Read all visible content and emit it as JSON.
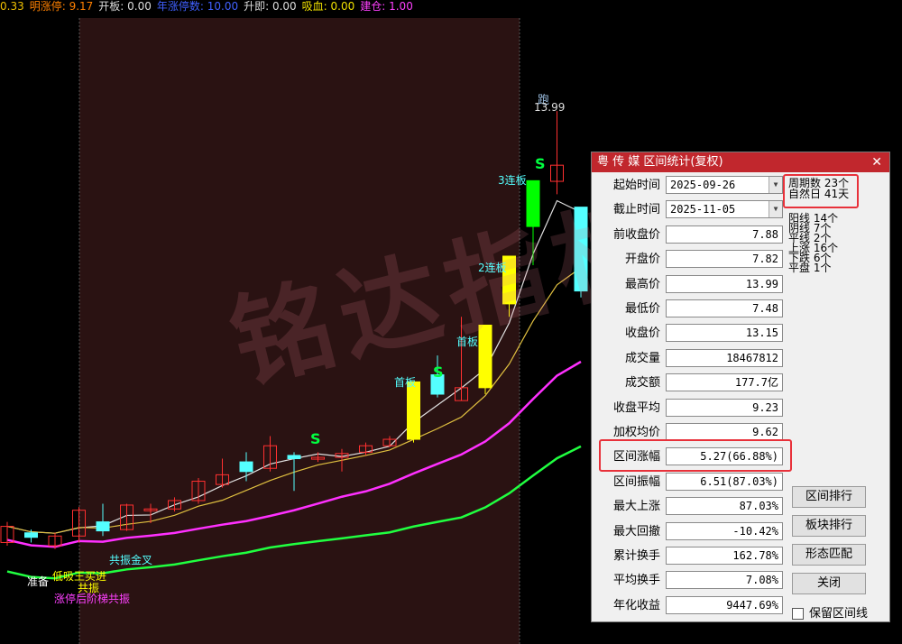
{
  "topbar": [
    {
      "text": "0.33",
      "color": "#f0c000"
    },
    {
      "text": "明涨停: 9.17",
      "color": "#ff8000"
    },
    {
      "text": "开板: 0.00",
      "color": "#dddddd"
    },
    {
      "text": "年涨停数: 10.00",
      "color": "#4060ff"
    },
    {
      "text": "升即: 0.00",
      "color": "#dddddd"
    },
    {
      "text": "吸血: 0.00",
      "color": "#f0e000"
    },
    {
      "text": "建仓: 1.00",
      "color": "#ff40ff"
    }
  ],
  "watermark": "铭达指标",
  "chart_labels": {
    "peak_run": "跑",
    "peak_value": "13.99",
    "limit3": "3连板",
    "limit2": "2连板",
    "first_board_a": "首板",
    "first_board_b": "首板",
    "s1": "S",
    "s2": "S",
    "s3": "S",
    "gold_cross": "共振金叉",
    "prepare": "准备",
    "text_a": "低吸王买进",
    "text_b": "共振",
    "text_c": "涨停后阶梯共振"
  },
  "dialog": {
    "title": "粤 传 媒 区间统计(复权)",
    "close": "✕",
    "rows": [
      {
        "label": "起始时间",
        "value": "2025-09-26",
        "type": "date"
      },
      {
        "label": "截止时间",
        "value": "2025-11-05",
        "type": "date"
      },
      {
        "label": "前收盘价",
        "value": "7.88"
      },
      {
        "label": "开盘价",
        "value": "7.82"
      },
      {
        "label": "最高价",
        "value": "13.99"
      },
      {
        "label": "最低价",
        "value": "7.48"
      },
      {
        "label": "收盘价",
        "value": "13.15"
      },
      {
        "label": "成交量",
        "value": "18467812"
      },
      {
        "label": "成交额",
        "value": "177.7亿"
      },
      {
        "label": "收盘平均",
        "value": "9.23"
      },
      {
        "label": "加权均价",
        "value": "9.62"
      },
      {
        "label": "区间涨幅",
        "value": "5.27(66.88%)"
      },
      {
        "label": "区间振幅",
        "value": "6.51(87.03%)"
      },
      {
        "label": "最大上涨",
        "value": "87.03%"
      },
      {
        "label": "最大回撤",
        "value": "-10.42%"
      },
      {
        "label": "累计换手",
        "value": "162.78%"
      },
      {
        "label": "平均换手",
        "value": "7.08%"
      },
      {
        "label": "年化收益",
        "value": "9447.69%"
      }
    ],
    "period": [
      "周期数  23个",
      "自然日  41天"
    ],
    "counts": [
      "阳线 14个",
      "阴线  7个",
      "平线  2个",
      "上涨 16个",
      "下跌  6个",
      "平盘  1个"
    ],
    "buttons": [
      "区间排行",
      "板块排行",
      "形态匹配",
      "关闭"
    ],
    "checkbox_label": "保留区间线"
  },
  "chart_data": {
    "type": "candlestick",
    "colors": {
      "up": "#ff3030",
      "down": "#54ffff",
      "limit_up": "#ffff00",
      "limit_up_3": "#00ff00"
    },
    "candles": [
      {
        "o": 7.3,
        "c": 7.55,
        "h": 7.62,
        "l": 7.25
      },
      {
        "o": 7.45,
        "c": 7.38,
        "h": 7.5,
        "l": 7.3
      },
      {
        "o": 7.25,
        "c": 7.4,
        "h": 7.45,
        "l": 7.2
      },
      {
        "o": 7.4,
        "c": 7.8,
        "h": 7.85,
        "l": 7.3
      },
      {
        "o": 7.62,
        "c": 7.48,
        "h": 7.9,
        "l": 7.4
      },
      {
        "o": 7.5,
        "c": 7.88,
        "h": 7.9,
        "l": 7.48
      },
      {
        "o": 7.82,
        "c": 7.82,
        "h": 7.9,
        "l": 7.6
      },
      {
        "o": 7.82,
        "c": 7.95,
        "h": 8.0,
        "l": 7.78
      },
      {
        "o": 7.95,
        "c": 8.25,
        "h": 8.3,
        "l": 7.9
      },
      {
        "o": 8.2,
        "c": 8.35,
        "h": 8.6,
        "l": 8.15
      },
      {
        "o": 8.55,
        "c": 8.4,
        "h": 8.7,
        "l": 8.25
      },
      {
        "o": 8.45,
        "c": 8.8,
        "h": 8.95,
        "l": 8.4
      },
      {
        "o": 8.65,
        "c": 8.6,
        "h": 8.7,
        "l": 8.1
      },
      {
        "o": 8.62,
        "c": 8.62,
        "h": 8.7,
        "l": 8.55
      },
      {
        "o": 8.62,
        "c": 8.68,
        "h": 8.75,
        "l": 8.4
      },
      {
        "o": 8.7,
        "c": 8.8,
        "h": 8.85,
        "l": 8.65
      },
      {
        "o": 8.8,
        "c": 8.9,
        "h": 8.95,
        "l": 8.78
      },
      {
        "o": 8.9,
        "c": 9.79,
        "h": 9.79,
        "l": 8.85
      },
      {
        "o": 9.9,
        "c": 9.6,
        "h": 10.2,
        "l": 9.55
      },
      {
        "o": 9.5,
        "c": 9.7,
        "h": 10.8,
        "l": 9.5
      },
      {
        "o": 9.7,
        "c": 10.67,
        "h": 10.67,
        "l": 9.6
      },
      {
        "o": 11.0,
        "c": 11.74,
        "h": 11.74,
        "l": 10.8
      },
      {
        "o": 12.2,
        "c": 12.91,
        "h": 12.91,
        "l": 11.6
      },
      {
        "o": 12.9,
        "c": 13.15,
        "h": 13.99,
        "l": 12.7
      },
      {
        "o": 12.5,
        "c": 11.2,
        "h": 12.5,
        "l": 11.1
      }
    ]
  }
}
